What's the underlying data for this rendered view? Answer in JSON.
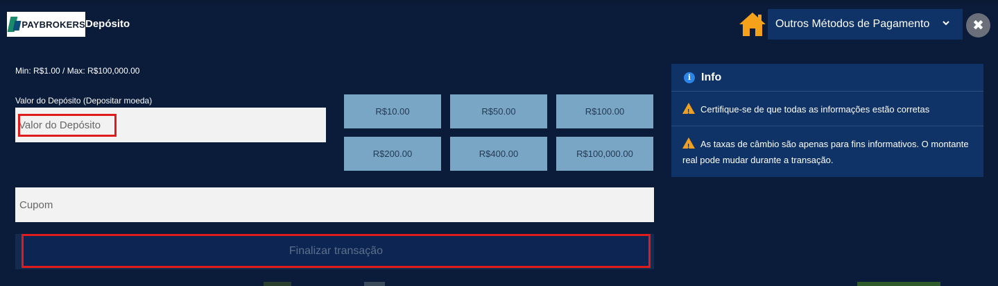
{
  "header": {
    "logo_text": "PAYBROKERS",
    "title": "Depósito",
    "method_select": "Outros Métodos de Pagamento",
    "close_symbol": "✖"
  },
  "form": {
    "limits": "Min: R$1.00 / Max: R$100,000.00",
    "amount_label": "Valor do Depósito (Depositar moeda)",
    "amount_placeholder": "Valor do Depósito",
    "quick_amounts": [
      "R$10.00",
      "R$50.00",
      "R$100.00",
      "R$200.00",
      "R$400.00",
      "R$100,000.00"
    ],
    "coupon_placeholder": "Cupom",
    "finalize_label": "Finalizar transação"
  },
  "info": {
    "title": "Info",
    "items": [
      "Certifique-se de que todas as informações estão corretas",
      "As taxas de câmbio são apenas para fins informativos. O montante real pode mudar durante a transação."
    ]
  },
  "colors": {
    "background": "#0b1c3a",
    "panel": "#0f3366",
    "quick_button": "#7aa6c6",
    "highlight": "#e01b1b",
    "home_icon": "#f5a21a",
    "warning": "#f0a020"
  },
  "icons": {
    "home": "home-icon",
    "chevron": "chevron-down-icon",
    "close": "close-icon",
    "info": "info-icon",
    "warning": "warning-icon"
  }
}
